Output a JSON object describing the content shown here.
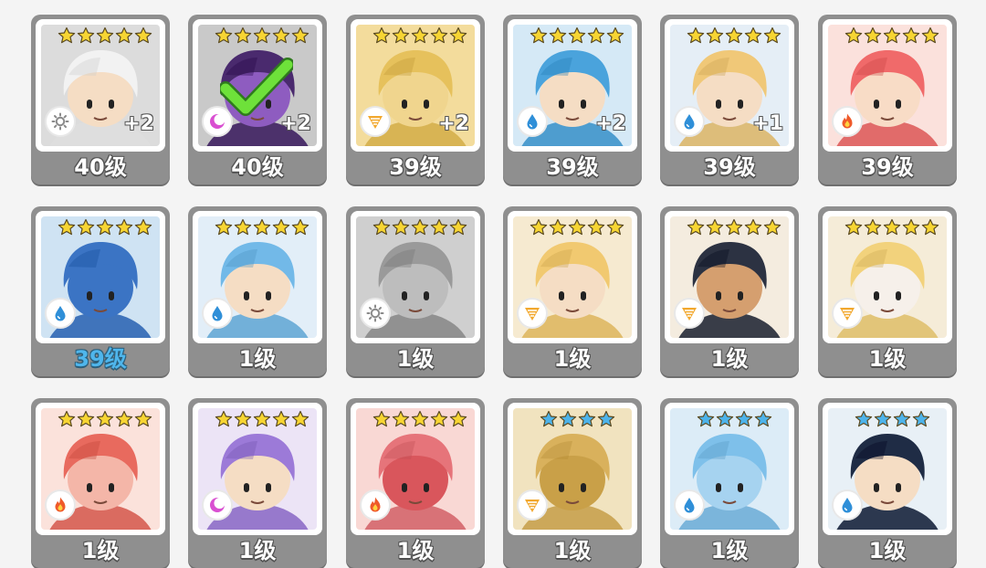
{
  "heroes": [
    {
      "level": "40级",
      "plus": "+2",
      "stars": 5,
      "star_color": "gold",
      "element": "sun-icon",
      "bg": "#dcdcdc",
      "hair": "#f2f2f2",
      "skin": "#f5ddc4"
    },
    {
      "level": "40级",
      "plus": "+2",
      "stars": 5,
      "star_color": "gold",
      "element": "moon-icon",
      "bg": "#c9c9c9",
      "hair": "#4a2a6e",
      "skin": "#8e5cc0",
      "checked": true
    },
    {
      "level": "39级",
      "plus": "+2",
      "stars": 5,
      "star_color": "gold",
      "element": "wind-icon",
      "bg": "#f3dc9c",
      "hair": "#e6c15c",
      "skin": "#f0d58e"
    },
    {
      "level": "39级",
      "plus": "+2",
      "stars": 5,
      "star_color": "gold",
      "element": "water-icon",
      "bg": "#d5e9f6",
      "hair": "#4aa3dc",
      "skin": "#f5ddc4"
    },
    {
      "level": "39级",
      "plus": "+1",
      "stars": 5,
      "star_color": "gold",
      "element": "water-icon",
      "bg": "#e5eef6",
      "hair": "#f0c878",
      "skin": "#f5ddc4"
    },
    {
      "level": "39级",
      "plus": "",
      "stars": 5,
      "star_color": "gold",
      "element": "fire-icon",
      "bg": "#fbe1dc",
      "hair": "#f06a6a",
      "skin": "#f8dcc6"
    },
    {
      "level": "39级",
      "plus": "",
      "stars": 5,
      "star_color": "gold",
      "element": "water-icon",
      "bg": "#cfe3f3",
      "hair": "#3b74c4",
      "skin": "#3b74c4",
      "selected": true
    },
    {
      "level": "1级",
      "plus": "",
      "stars": 5,
      "star_color": "gold",
      "element": "water-icon",
      "bg": "#e2eef8",
      "hair": "#72b9e8",
      "skin": "#f5ddc4"
    },
    {
      "level": "1级",
      "plus": "",
      "stars": 5,
      "star_color": "gold",
      "element": "sun-icon",
      "bg": "#cfcfcf",
      "hair": "#9a9a9a",
      "skin": "#bdbdbd"
    },
    {
      "level": "1级",
      "plus": "",
      "stars": 5,
      "star_color": "gold",
      "element": "wind-icon",
      "bg": "#f6ead0",
      "hair": "#f1c970",
      "skin": "#f5ddc4"
    },
    {
      "level": "1级",
      "plus": "",
      "stars": 5,
      "star_color": "gold",
      "element": "wind-icon",
      "bg": "#f4ecdf",
      "hair": "#2c3242",
      "skin": "#d59f6f"
    },
    {
      "level": "1级",
      "plus": "",
      "stars": 5,
      "star_color": "gold",
      "element": "wind-icon",
      "bg": "#f5ecd8",
      "hair": "#f2d27c",
      "skin": "#f6f0ea"
    },
    {
      "level": "1级",
      "plus": "",
      "stars": 5,
      "star_color": "gold",
      "element": "fire-icon",
      "bg": "#fbe2db",
      "hair": "#e86a5e",
      "skin": "#f4b6a8"
    },
    {
      "level": "1级",
      "plus": "",
      "stars": 5,
      "star_color": "gold",
      "element": "moon-icon",
      "bg": "#ece4f6",
      "hair": "#9c7ad8",
      "skin": "#f5ddc4"
    },
    {
      "level": "1级",
      "plus": "",
      "stars": 5,
      "star_color": "gold",
      "element": "fire-icon",
      "bg": "#f9d8d4",
      "hair": "#e6747a",
      "skin": "#d9565c"
    },
    {
      "level": "1级",
      "plus": "",
      "stars": 4,
      "star_color": "blue",
      "element": "wind-icon",
      "bg": "#f1e3bf",
      "hair": "#d9b15c",
      "skin": "#c9a048"
    },
    {
      "level": "1级",
      "plus": "",
      "stars": 4,
      "star_color": "blue",
      "element": "water-icon",
      "bg": "#dcecf7",
      "hair": "#7ec0ea",
      "skin": "#a6d3f0"
    },
    {
      "level": "1级",
      "plus": "",
      "stars": 4,
      "star_color": "blue",
      "element": "water-icon",
      "bg": "#e8f0f6",
      "hair": "#1f2c45",
      "skin": "#f5ddc4"
    }
  ],
  "colors": {
    "star_gold": "#f7d533",
    "star_blue": "#4db3ea",
    "selected_label": "#4fb6ec",
    "card_frame": "#8f8f8f"
  }
}
